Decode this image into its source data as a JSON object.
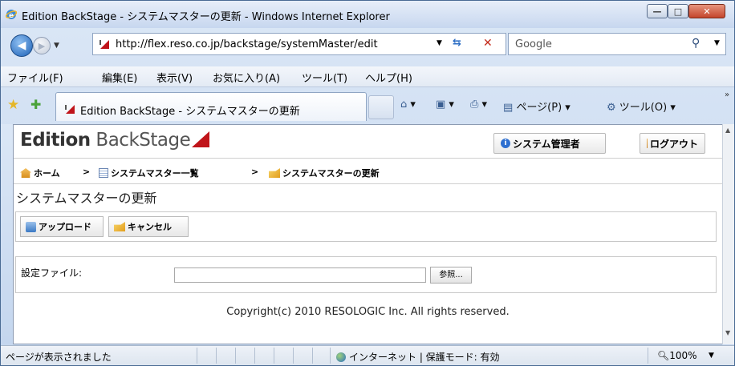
{
  "window": {
    "title": "Edition BackStage - システムマスターの更新 - Windows Internet Explorer",
    "min_glyph": "—",
    "max_glyph": "□",
    "close_glyph": "✕"
  },
  "address": {
    "url": "http://flex.reso.co.jp/backstage/systemMaster/edit",
    "search_engine": "Google"
  },
  "menu": {
    "items": [
      "ファイル(F)",
      "編集(E)",
      "表示(V)",
      "お気に入り(A)",
      "ツール(T)",
      "ヘルプ(H)"
    ]
  },
  "tab": {
    "label": "Edition BackStage - システムマスターの更新"
  },
  "commands": {
    "page_label": "ページ(P)",
    "tools_label": "ツール(O)"
  },
  "app": {
    "logo_part1": "Edition",
    "logo_part2": " BackStage",
    "sys_admin_label": "システム管理者",
    "logout_label": "ログアウト",
    "breadcrumb": {
      "home": "ホーム",
      "list": "システムマスター一覧",
      "current": "システムマスターの更新",
      "separator": ">"
    },
    "page_title": "システムマスターの更新",
    "toolbar": {
      "upload_label": "アップロード",
      "cancel_label": "キャンセル"
    },
    "form": {
      "file_label": "設定ファイル:",
      "file_value": "",
      "browse_label": "参照..."
    },
    "copyright": "Copyright(c) 2010 RESOLOGIC Inc. All rights reserved."
  },
  "status": {
    "message": "ページが表示されました",
    "zone": "インターネット | 保護モード: 有効",
    "zoom": "100%"
  },
  "colors": {
    "logo_accent": "#c0141a",
    "ie_chrome": "#c4d6ee"
  }
}
